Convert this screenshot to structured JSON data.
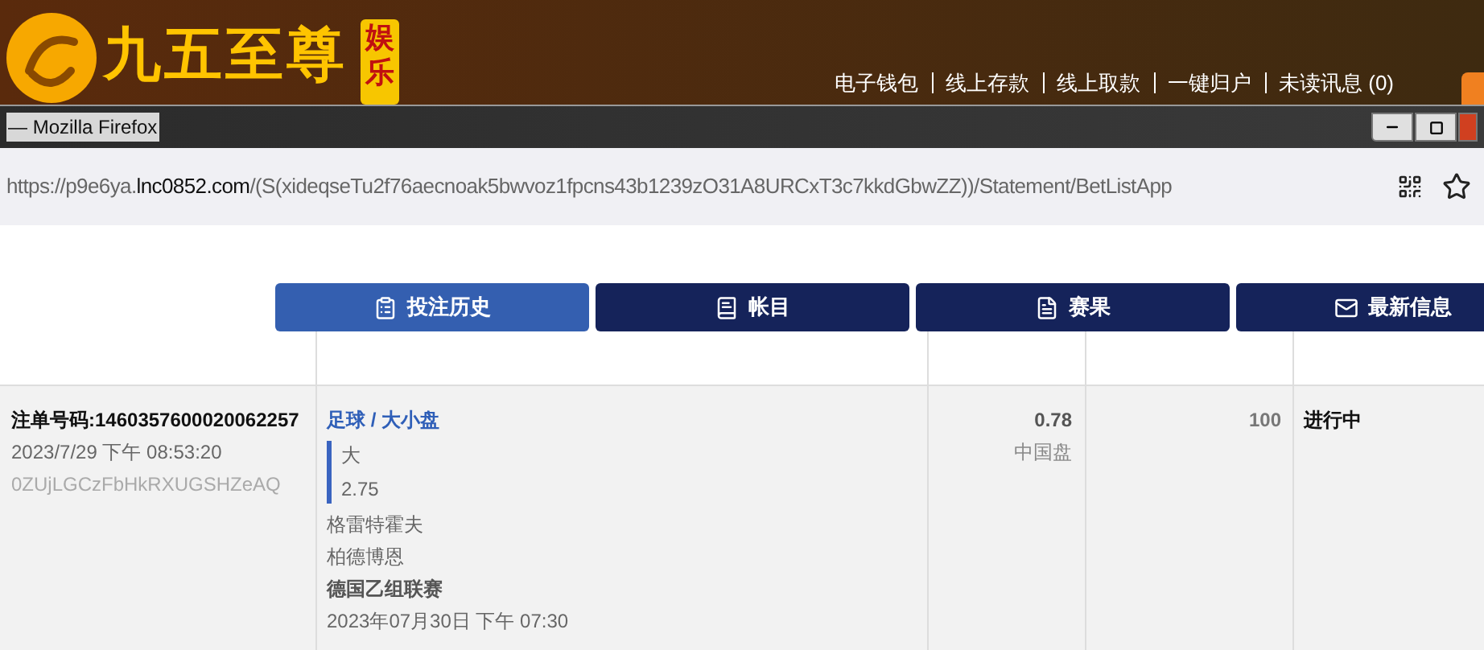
{
  "banner": {
    "logo_text": "九五至尊",
    "logo_badge": "娱乐",
    "links": [
      "电子钱包",
      "线上存款",
      "线上取款",
      "一键归户",
      "未读讯息 (0)"
    ]
  },
  "browser": {
    "title": "— Mozilla Firefox",
    "url": {
      "prefix": "https://p9e6ya.",
      "domain": "lnc0852.com",
      "path": "/(S(xideqseTu2f76aecnoak5bwvoz1fpcns43b1239zO31A8URCxT3c7kkdGbwZZ))/Statement/BetListApp"
    }
  },
  "tabs": [
    {
      "label": "投注历史",
      "selected": true
    },
    {
      "label": "帐目",
      "selected": false
    },
    {
      "label": "赛果",
      "selected": false
    },
    {
      "label": "最新信息",
      "selected": false
    }
  ],
  "bet": {
    "ticket": "注单号码:1460357600020062257",
    "time": "2023/7/29 下午 08:53:20",
    "code": "0ZUjLGCzFbHkRXUGSHZeAQ",
    "sport_market": "足球 / 大小盘",
    "selection": "大",
    "line": "2.75",
    "home": "格雷特霍夫",
    "away": "柏德博恩",
    "league": "德国乙组联赛",
    "match_time": "2023年07月30日 下午 07:30",
    "odds": "0.78",
    "odds_type": "中国盘",
    "stake": "100",
    "status": "进行中"
  }
}
